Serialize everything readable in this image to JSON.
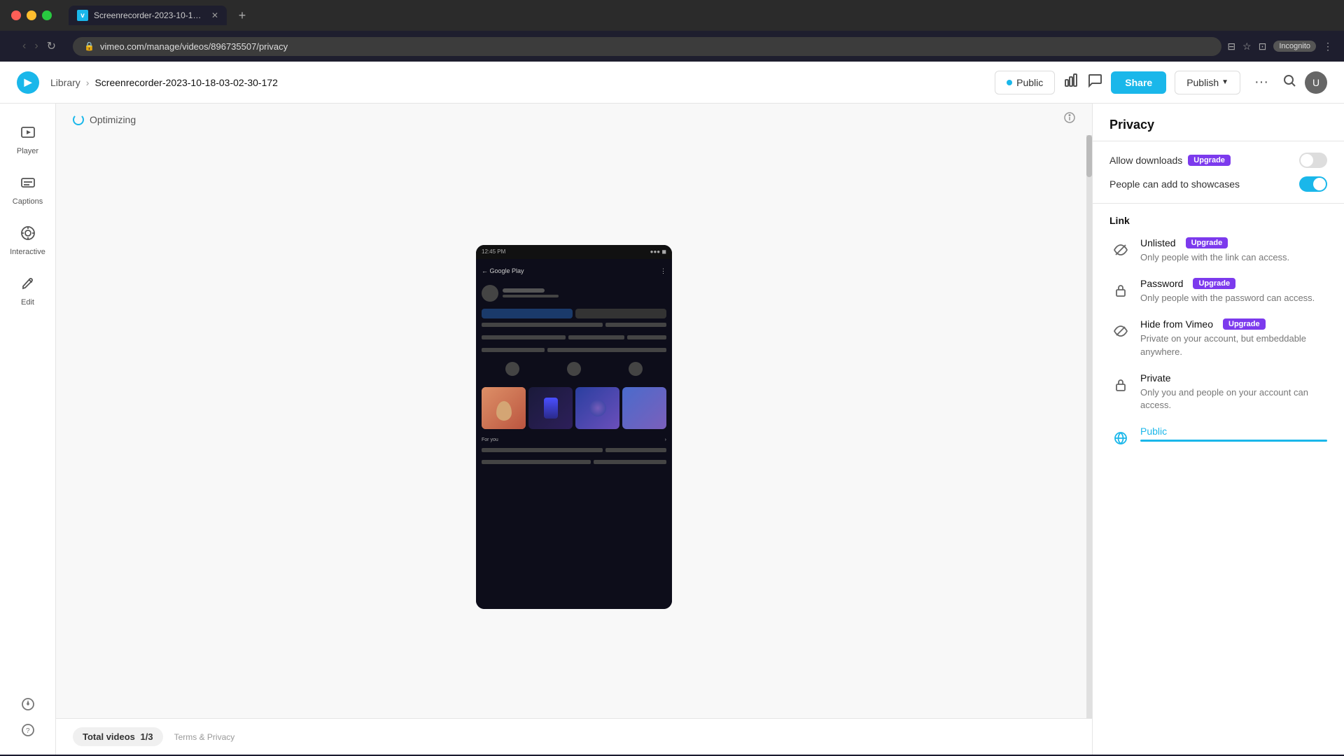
{
  "browser": {
    "url": "vimeo.com/manage/videos/896735507/privacy",
    "tab_title": "Screenrecorder-2023-10-18-03...",
    "tab_favicon": "V",
    "incognito_label": "Incognito"
  },
  "nav": {
    "logo": "V",
    "library_label": "Library",
    "breadcrumb_separator": "›",
    "video_title": "Screenrecorder-2023-10-18-03-02-30-172",
    "public_label": "Public",
    "share_label": "Share",
    "publish_label": "Publish",
    "more_label": "···"
  },
  "sidebar": {
    "items": [
      {
        "id": "player",
        "label": "Player",
        "icon": "⊡"
      },
      {
        "id": "captions",
        "label": "Captions",
        "icon": "⊟"
      },
      {
        "id": "interactive",
        "label": "Interactive",
        "icon": "⊕"
      },
      {
        "id": "edit",
        "label": "Edit",
        "icon": "✂"
      }
    ],
    "bottom_icons": [
      "⊙",
      "?"
    ]
  },
  "video_area": {
    "optimizing_label": "Optimizing",
    "status_bar": {
      "total_label": "Total videos",
      "count": "1/3",
      "terms_label": "Terms & Privacy"
    }
  },
  "privacy_panel": {
    "title": "Privacy",
    "allow_downloads_label": "Allow downloads",
    "allow_downloads_upgrade": "Upgrade",
    "allow_downloads_toggle": "off",
    "showcases_label": "People can add to showcases",
    "showcases_toggle": "on",
    "link_section_title": "Link",
    "link_options": [
      {
        "id": "unlisted",
        "name": "Unlisted",
        "upgrade": "Upgrade",
        "description": "Only people with the link can access.",
        "icon": "👁",
        "selected": false
      },
      {
        "id": "password",
        "name": "Password",
        "upgrade": "Upgrade",
        "description": "Only people with the password can access.",
        "icon": "🔒",
        "selected": false
      },
      {
        "id": "hide_from_vimeo",
        "name": "Hide from Vimeo",
        "upgrade": "Upgrade",
        "description": "Private on your account, but embeddable anywhere.",
        "icon": "👁",
        "selected": false
      },
      {
        "id": "private",
        "name": "Private",
        "upgrade": null,
        "description": "Only you and people on your account can access.",
        "icon": "🔒",
        "selected": false
      },
      {
        "id": "public",
        "name": "Public",
        "upgrade": null,
        "description": "",
        "icon": "🌐",
        "selected": true
      }
    ]
  }
}
